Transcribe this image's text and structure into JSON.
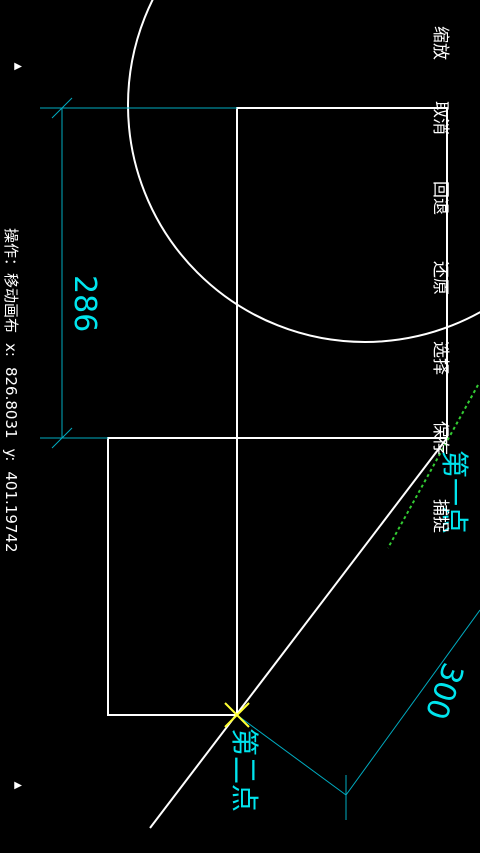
{
  "toolbar": {
    "items": [
      "缩放",
      "取消",
      "回退",
      "还原",
      "选择",
      "保存",
      "捕捉"
    ]
  },
  "status": {
    "operation": "操作：移动画布",
    "x_label": "x:",
    "x_value": "826.8031",
    "y_label": "y:",
    "y_value": "401.19742"
  },
  "dimensions": {
    "vertical": "286",
    "diagonal": "300"
  },
  "points": {
    "first": "第一点",
    "second": "第二点"
  },
  "colors": {
    "background": "#000000",
    "lines": "#ffffff",
    "dimension": "#00bcd4",
    "label": "#00e5ee",
    "marker": "#ffff33",
    "snap": "#33cc33"
  },
  "icons": {
    "top_arrow": "triangle-up-icon",
    "bottom_arrow": "triangle-up-icon"
  }
}
